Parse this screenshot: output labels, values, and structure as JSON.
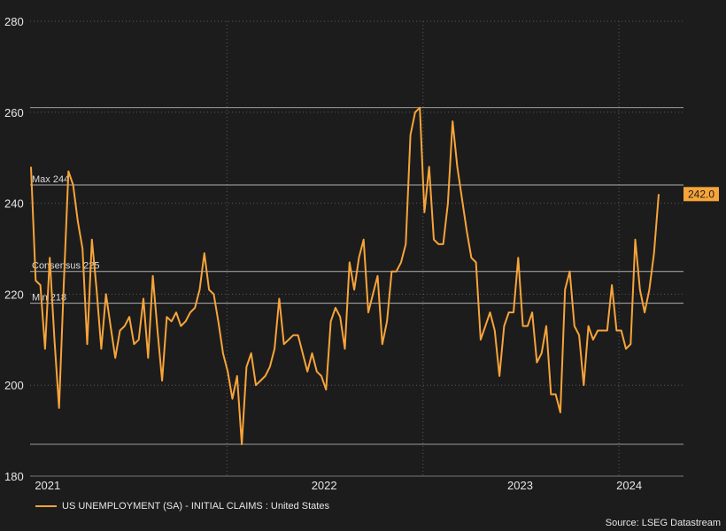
{
  "chart_data": {
    "type": "line",
    "title": "",
    "xlabel": "",
    "ylabel": "",
    "ylim": [
      180,
      280
    ],
    "y_ticks": [
      180,
      200,
      220,
      240,
      260,
      280
    ],
    "x_ticks": [
      "2021",
      "2022",
      "2023",
      "2024"
    ],
    "grid": "dotted",
    "legend": "bottom-left",
    "series": [
      {
        "name": "US UNEMPLOYMENT (SA) - INITIAL CLAIMS : United States",
        "color": "#f7a43a",
        "start": "2021-01-01",
        "end": "2024-03-15",
        "values": [
          248,
          223,
          222,
          208,
          228,
          210,
          195,
          222,
          247,
          244,
          236,
          230,
          209,
          232,
          221,
          208,
          220,
          213,
          206,
          212,
          213,
          215,
          209,
          210,
          219,
          206,
          224,
          212,
          201,
          215,
          214,
          216,
          213,
          214,
          216,
          217,
          221,
          229,
          221,
          220,
          214,
          207,
          203,
          197,
          202,
          187,
          204,
          207,
          200,
          201,
          202,
          204,
          208,
          219,
          209,
          210,
          211,
          211,
          207,
          203,
          207,
          203,
          202,
          199,
          214,
          217,
          215,
          208,
          227,
          221,
          228,
          232,
          216,
          220,
          224,
          209,
          214,
          225,
          225,
          227,
          231,
          255,
          260,
          261,
          238,
          248,
          232,
          231,
          231,
          240,
          258,
          248,
          241,
          234,
          228,
          227,
          210,
          213,
          216,
          212,
          202,
          213,
          216,
          216,
          228,
          213,
          213,
          216,
          205,
          207,
          213,
          198,
          198,
          194,
          221,
          225,
          213,
          211,
          200,
          213,
          210,
          212,
          212,
          212,
          222,
          212,
          212,
          208,
          209,
          232,
          221,
          216,
          221,
          229,
          242
        ]
      }
    ],
    "reference_lines": [
      {
        "label": "Max 244",
        "value": 244
      },
      {
        "label": "Consensus 225",
        "value": 225
      },
      {
        "label": "Min 218",
        "value": 218
      }
    ],
    "extra_gridlines": [
      261,
      187
    ],
    "last_value_label": "242.0",
    "source": "Source: LSEG Datastream"
  }
}
